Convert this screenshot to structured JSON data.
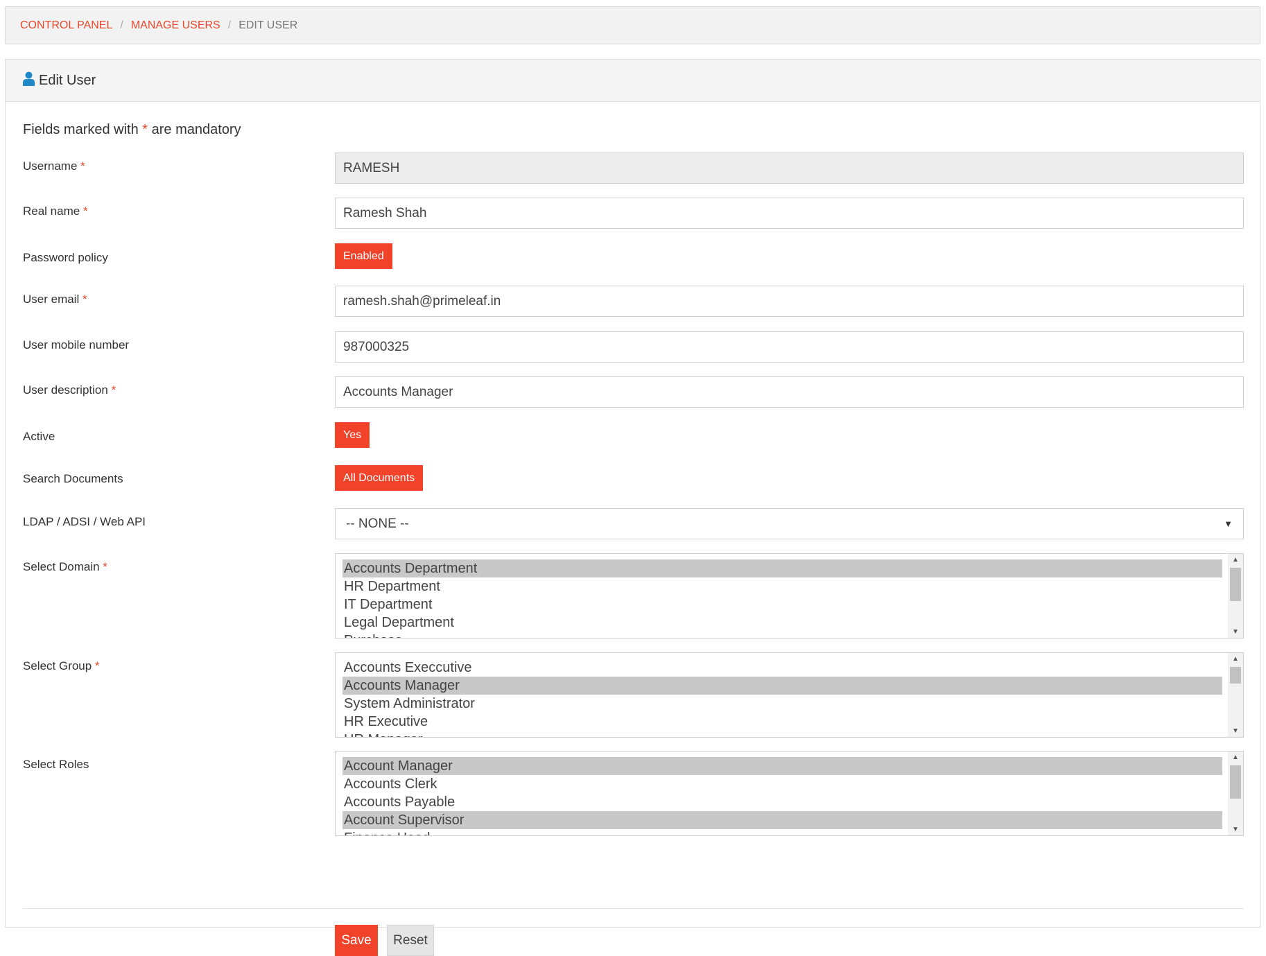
{
  "breadcrumb": {
    "items": [
      "CONTROL PANEL",
      "MANAGE USERS"
    ],
    "current": "EDIT USER",
    "separator": "/"
  },
  "panel": {
    "title": "Edit User",
    "icon": "user-icon"
  },
  "form": {
    "mandatory_prefix": "Fields marked with",
    "mandatory_mark": "*",
    "mandatory_suffix": "are mandatory",
    "username": {
      "label": "Username",
      "value": "RAMESH"
    },
    "real_name": {
      "label": "Real name",
      "value": "Ramesh Shah"
    },
    "password_policy": {
      "label": "Password policy",
      "value": "Enabled"
    },
    "user_email": {
      "label": "User email",
      "value": "ramesh.shah@primeleaf.in"
    },
    "user_mobile": {
      "label": "User mobile number",
      "value": "987000325"
    },
    "user_description": {
      "label": "User description",
      "value": "Accounts Manager"
    },
    "active": {
      "label": "Active",
      "value": "Yes"
    },
    "search_documents": {
      "label": "Search Documents",
      "value": "All Documents"
    },
    "ldap": {
      "label": "LDAP / ADSI / Web API",
      "value": "-- NONE --"
    },
    "domain": {
      "label": "Select Domain",
      "options": [
        "Accounts Department",
        "HR Department",
        "IT Department",
        "Legal Department",
        "Purchase"
      ],
      "selected": [
        "Accounts Department"
      ]
    },
    "group": {
      "label": "Select Group",
      "options": [
        "Accounts Execcutive",
        "Accounts Manager",
        "System Administrator",
        "HR Executive",
        "HR Manager"
      ],
      "selected": [
        "Accounts Manager"
      ]
    },
    "roles": {
      "label": "Select Roles",
      "options": [
        "Account Manager",
        "Accounts Clerk",
        "Accounts Payable",
        "Account Supervisor",
        "Finance Head"
      ],
      "selected": [
        "Account Manager",
        "Account Supervisor"
      ]
    }
  },
  "actions": {
    "save": "Save",
    "reset": "Reset"
  },
  "colors": {
    "accent": "#f0432a",
    "link": "#e8472c",
    "selected_option": "#c8c8c8"
  }
}
